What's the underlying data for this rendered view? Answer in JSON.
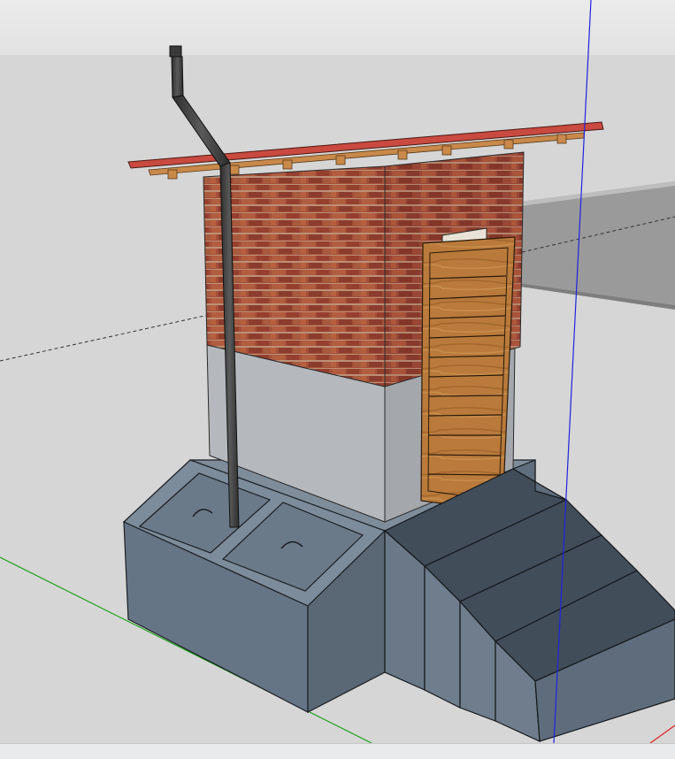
{
  "window": {
    "title": ""
  },
  "viewport": {
    "sky_color": "#e8e8e8",
    "ground_color": "#d6d6d6",
    "axis_colors": {
      "red": "#d22",
      "green": "#1aa01a",
      "blue": "#2222dd"
    }
  },
  "model": {
    "subject": "latrine-building",
    "materials": {
      "brick": "#a4503a",
      "concrete": "#a8abb0",
      "slab": "#6b7a8a",
      "step_top": "#414d59",
      "door_wood": "#b87a3c",
      "roof_sheet": "#c94a40",
      "roof_purlin": "#c8894a",
      "pipe": "#4a4a4a"
    }
  }
}
